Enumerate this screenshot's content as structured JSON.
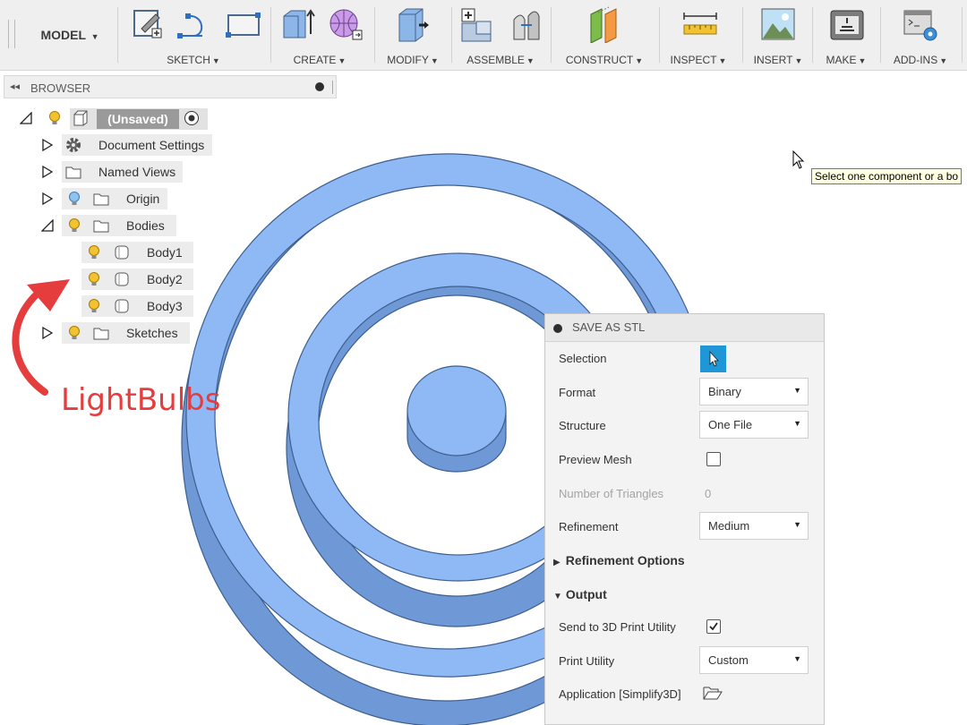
{
  "toolbar": {
    "model_label": "MODEL",
    "groups": [
      {
        "label": "SKETCH"
      },
      {
        "label": "CREATE"
      },
      {
        "label": "MODIFY"
      },
      {
        "label": "ASSEMBLE"
      },
      {
        "label": "CONSTRUCT"
      },
      {
        "label": "INSPECT"
      },
      {
        "label": "INSERT"
      },
      {
        "label": "MAKE"
      },
      {
        "label": "ADD-INS"
      }
    ]
  },
  "browser": {
    "title": "BROWSER",
    "root_label": "(Unsaved)",
    "items": [
      {
        "label": "Document Settings"
      },
      {
        "label": "Named Views"
      },
      {
        "label": "Origin"
      },
      {
        "label": "Bodies"
      },
      {
        "label": "Body1"
      },
      {
        "label": "Body2"
      },
      {
        "label": "Body3"
      },
      {
        "label": "Sketches"
      }
    ]
  },
  "annotation": {
    "text": "LightBulbs",
    "color": "#e53d3d"
  },
  "tooltip": {
    "text": "Select one component or a bo"
  },
  "dialog": {
    "title": "SAVE AS STL",
    "selection_label": "Selection",
    "format_label": "Format",
    "format_value": "Binary",
    "structure_label": "Structure",
    "structure_value": "One File",
    "preview_mesh_label": "Preview Mesh",
    "preview_mesh_checked": false,
    "triangles_label": "Number of Triangles",
    "triangles_value": "0",
    "refinement_label": "Refinement",
    "refinement_value": "Medium",
    "refinement_options_label": "Refinement Options",
    "output_label": "Output",
    "send_label": "Send to 3D Print Utility",
    "send_checked": true,
    "print_utility_label": "Print Utility",
    "print_utility_value": "Custom",
    "application_label": "Application [Simplify3D]"
  },
  "colors": {
    "body_fill": "#8fb9f5",
    "body_side": "#6f98d6",
    "selection_button": "#1f96d6",
    "bulb_on": "#f2c230",
    "bulb_off": "#8fc3ef"
  }
}
